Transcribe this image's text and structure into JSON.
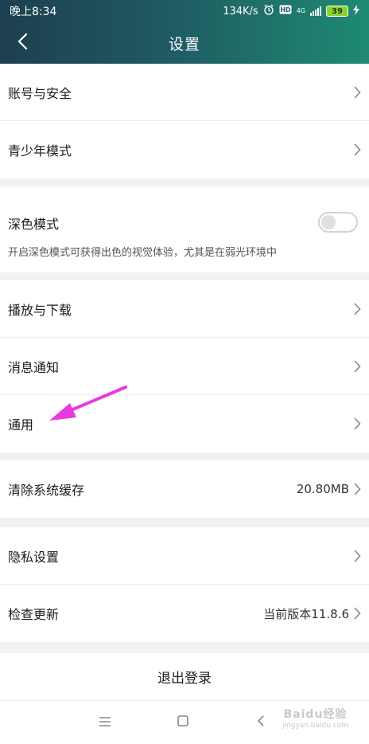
{
  "status_bar": {
    "time": "晚上8:34",
    "speed": "134K/s",
    "network": "4G",
    "battery": "39",
    "icons": [
      "alarm-icon",
      "hd-icon",
      "signal-icon",
      "battery-icon",
      "charging-icon"
    ]
  },
  "header": {
    "title": "设置"
  },
  "sections": {
    "account": [
      {
        "label": "账号与安全"
      },
      {
        "label": "青少年模式"
      }
    ],
    "dark_mode": {
      "label": "深色模式",
      "description": "开启深色模式可获得出色的视觉体验，尤其是在弱光环境中",
      "enabled": false
    },
    "general": [
      {
        "label": "播放与下载"
      },
      {
        "label": "消息通知"
      },
      {
        "label": "通用"
      }
    ],
    "cache": {
      "label": "清除系统缓存",
      "value": "20.80MB"
    },
    "other": [
      {
        "label": "隐私设置"
      },
      {
        "label": "检查更新",
        "value": "当前版本11.8.6"
      }
    ]
  },
  "logout": {
    "label": "退出登录"
  },
  "watermark": {
    "main": "Baidu经验",
    "sub": "jingyan.baidu.com"
  },
  "colors": {
    "header_start": "#1d3f4f",
    "header_end": "#1f8a72",
    "annotation_arrow": "#e93ae0",
    "battery": "#8bd42a"
  }
}
